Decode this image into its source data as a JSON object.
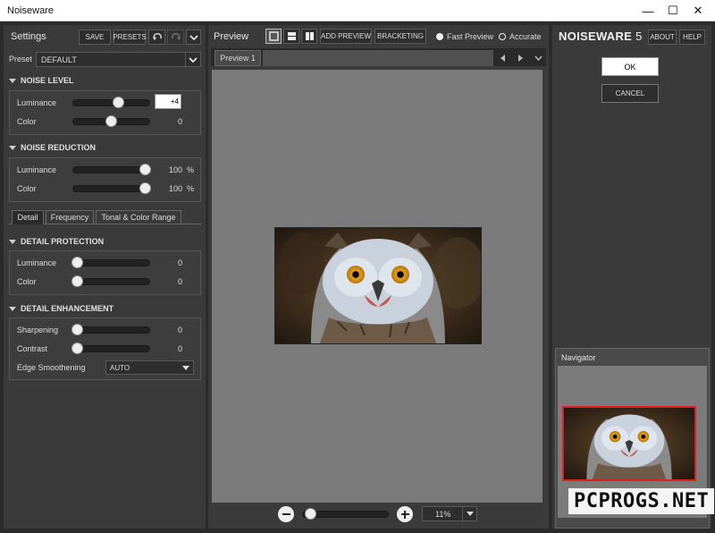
{
  "window": {
    "title": "Noiseware",
    "minimize": "—",
    "maximize": "☐",
    "close": "✕"
  },
  "settings": {
    "title": "Settings",
    "save": "SAVE",
    "presets": "PRESETS",
    "undo_icon": "undo-icon",
    "redo_icon": "redo-icon",
    "preset_label": "Preset",
    "preset_value": "DEFAULT",
    "noise_level": {
      "header": "NOISE LEVEL",
      "rows": [
        {
          "label": "Luminance",
          "value": "+4",
          "level": 0.6
        },
        {
          "label": "Color",
          "value": "0",
          "level": 0.5
        }
      ]
    },
    "noise_reduction": {
      "header": "NOISE REDUCTION",
      "rows": [
        {
          "label": "Luminance",
          "value": "100",
          "unit": "%",
          "level": 1.0
        },
        {
          "label": "Color",
          "value": "100",
          "unit": "%",
          "level": 1.0
        }
      ]
    },
    "tabs": [
      "Detail",
      "Frequency",
      "Tonal & Color Range"
    ],
    "detail_protection": {
      "header": "DETAIL PROTECTION",
      "rows": [
        {
          "label": "Luminance",
          "value": "0",
          "level": 0
        },
        {
          "label": "Color",
          "value": "0",
          "level": 0
        }
      ]
    },
    "detail_enhancement": {
      "header": "DETAIL ENHANCEMENT",
      "rows": [
        {
          "label": "Sharpening",
          "value": "0",
          "level": 0
        },
        {
          "label": "Contrast",
          "value": "0",
          "level": 0
        }
      ],
      "edge_label": "Edge Smoothening",
      "edge_value": "AUTO"
    }
  },
  "preview": {
    "title": "Preview",
    "add_preview": "ADD PREVIEW",
    "bracketing": "BRACKETING",
    "fast_preview": "Fast Preview",
    "accurate": "Accurate",
    "tab": "Preview 1",
    "zoom": "11%",
    "zoom_level": 0.05
  },
  "right": {
    "brand": "NOISEWARE",
    "version": "5",
    "about": "ABOUT",
    "help": "HELP",
    "ok": "OK",
    "cancel": "CANCEL",
    "navigator": "Navigator",
    "watermark": "PCPROGS.NET"
  }
}
